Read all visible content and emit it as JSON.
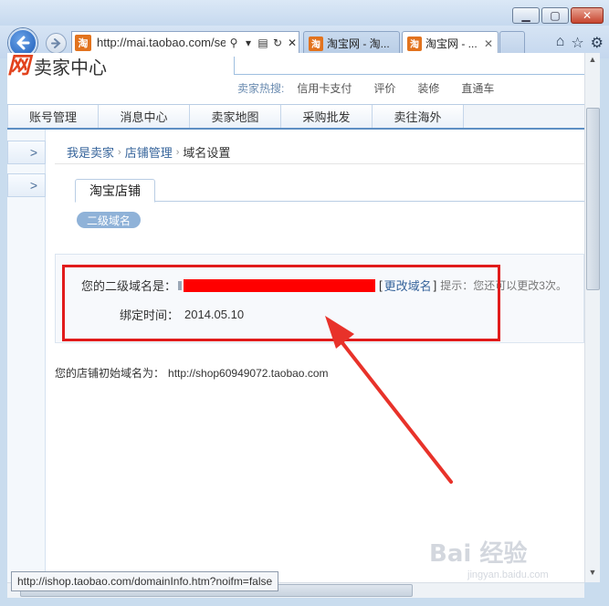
{
  "browser": {
    "url": "http://mai.taobao.com/sell",
    "tabs": [
      {
        "label": "淘宝网 - 淘..."
      },
      {
        "label": "淘宝网 - ..."
      }
    ],
    "favicon_char": "淘",
    "status_url": "http://ishop.taobao.com/domainInfo.htm?noifm=false"
  },
  "header": {
    "logo_mark": "网",
    "logo_text": "卖家中心",
    "hot_title": "卖家热搜:",
    "hot_items": [
      "信用卡支付",
      "评价",
      "装修",
      "直通车"
    ]
  },
  "nav": {
    "items": [
      "账号管理",
      "消息中心",
      "卖家地图",
      "采购批发",
      "卖往海外"
    ]
  },
  "sidebar": {
    "arrow": ">"
  },
  "breadcrumb": {
    "items": [
      "我是卖家",
      "店铺管理"
    ],
    "current": "域名设置",
    "sep": "›"
  },
  "shop_tab": "淘宝店铺",
  "pill_label": "二级域名",
  "domain_info": {
    "subdomain_label": "您的二级域名是：",
    "change_link": "更改域名",
    "bracket_open": "[",
    "bracket_close": "]",
    "hint": "提示：您还可以更改3次。",
    "bind_time_label": "绑定时间：",
    "bind_time_value": "2014.05.10"
  },
  "initial_domain": {
    "label": "您的店铺初始域名为：",
    "url": "http://shop60949072.taobao.com"
  },
  "watermark": {
    "main": "Bai 经验",
    "sub": "jingyan.baidu.com"
  },
  "colors": {
    "accent_red": "#e11b1b",
    "link_blue": "#36649b",
    "brand_orange": "#e2431e"
  }
}
